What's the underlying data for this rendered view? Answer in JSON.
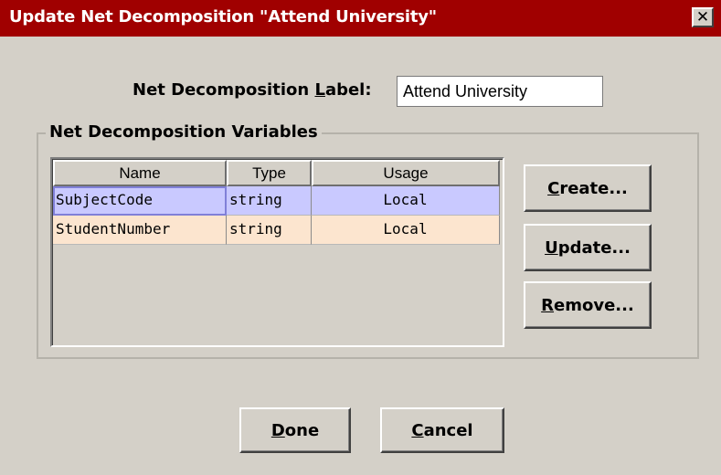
{
  "window": {
    "title": "Update Net Decomposition  \"Attend University\"",
    "close_glyph": "✕"
  },
  "label_field": {
    "label_mnemonic_prefix": "Net Decomposition ",
    "label_mnemonic_char": "L",
    "label_mnemonic_suffix": "abel:",
    "value": "Attend University"
  },
  "variables_group": {
    "title": "Net Decomposition Variables",
    "columns": [
      "Name",
      "Type",
      "Usage"
    ],
    "rows": [
      {
        "name": "SubjectCode",
        "type": "string",
        "usage": "Local"
      },
      {
        "name": "StudentNumber",
        "type": "string",
        "usage": "Local"
      }
    ]
  },
  "side_buttons": {
    "create": {
      "mnemonic": "C",
      "rest": "reate..."
    },
    "update": {
      "mnemonic": "U",
      "rest": "pdate..."
    },
    "remove": {
      "mnemonic": "R",
      "rest": "emove..."
    }
  },
  "bottom_buttons": {
    "done": {
      "mnemonic": "D",
      "rest": "one"
    },
    "cancel": {
      "mnemonic": "C",
      "rest": "ancel"
    }
  },
  "colors": {
    "titlebar": "#a00000",
    "selected_row": "#c9c9ff",
    "alt_row": "#fce5cf",
    "dialog_bg": "#d4d0c8"
  }
}
